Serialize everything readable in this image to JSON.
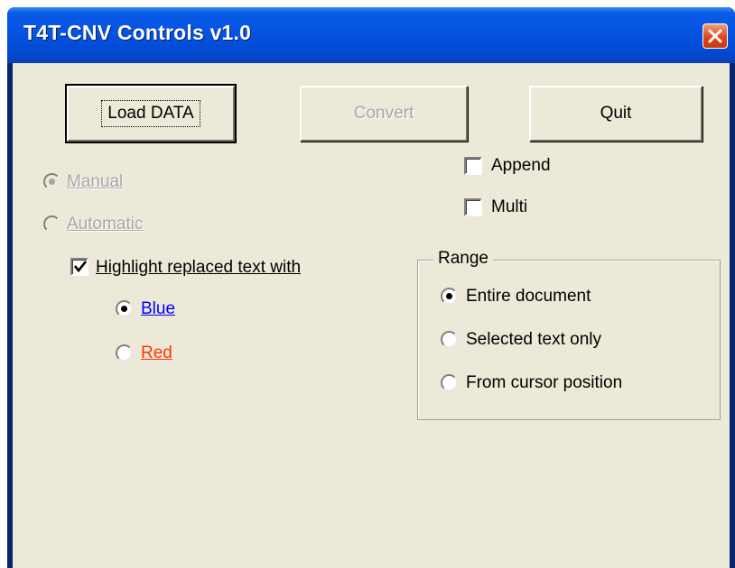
{
  "window": {
    "title": "T4T-CNV Controls v1.0"
  },
  "buttons": {
    "load": "Load DATA",
    "convert": "Convert",
    "quit": "Quit"
  },
  "mode": {
    "manual": {
      "label": "Manual",
      "selected": true,
      "enabled": false
    },
    "automatic": {
      "label": "Automatic",
      "selected": false,
      "enabled": false
    }
  },
  "options": {
    "append": {
      "label": "Append",
      "checked": false
    },
    "multi": {
      "label": "Multi",
      "checked": false
    }
  },
  "highlight": {
    "label": "Highlight replaced text with",
    "checked": true,
    "blue": {
      "label": "Blue",
      "color": "#0000ff",
      "selected": true
    },
    "red": {
      "label": "Red",
      "color": "#ff3300",
      "selected": false
    }
  },
  "range": {
    "title": "Range",
    "entire": {
      "label": "Entire document",
      "selected": true
    },
    "selected": {
      "label": "Selected text only",
      "selected": false
    },
    "cursor": {
      "label": "From cursor position",
      "selected": false
    }
  }
}
